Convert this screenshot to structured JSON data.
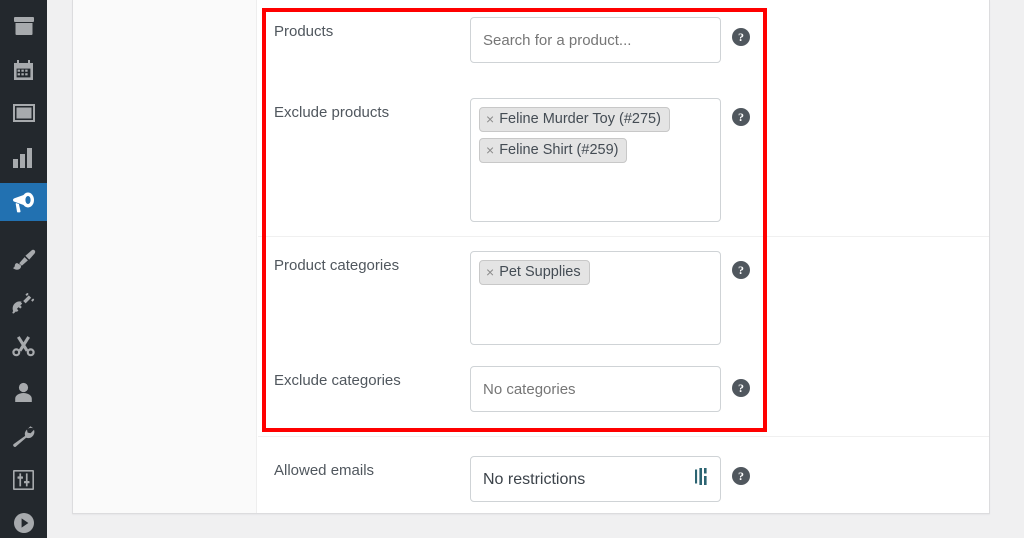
{
  "sidebar": {
    "items": [
      {
        "name": "archive-icon",
        "label": "Archive",
        "active": false
      },
      {
        "name": "calendar-icon",
        "label": "Bookings",
        "active": false
      },
      {
        "name": "cash-icon",
        "label": "Payments",
        "active": false
      },
      {
        "name": "bar-chart-icon",
        "label": "Analytics",
        "active": false
      },
      {
        "name": "megaphone-icon",
        "label": "Marketing",
        "active": true
      },
      {
        "name": "paintbrush-icon",
        "label": "Appearance",
        "active": false
      },
      {
        "name": "plug-icon",
        "label": "Plugins",
        "active": false
      },
      {
        "name": "scissors-icon",
        "label": "Coupons",
        "active": false
      },
      {
        "name": "user-icon",
        "label": "Users",
        "active": false
      },
      {
        "name": "wrench-icon",
        "label": "Tools",
        "active": false
      },
      {
        "name": "sliders-icon",
        "label": "Settings",
        "active": false
      },
      {
        "name": "play-circle-icon",
        "label": "Media",
        "active": false
      }
    ]
  },
  "colors": {
    "sidebar_bg": "#23282d",
    "sidebar_active": "#2271b1",
    "highlight_border": "#ff0000",
    "help_bubble": "#50575e",
    "resize_glyph": "#2c6472"
  },
  "help_icon_glyph": "?",
  "chip_remove_glyph": "×",
  "fields": [
    {
      "id": "products",
      "label": "Products",
      "control": "search-select",
      "placeholder": "Search for a product...",
      "value": "",
      "chips": [],
      "help": "help-tip-icon"
    },
    {
      "id": "exclude-products",
      "label": "Exclude products",
      "control": "multi-select",
      "placeholder": "",
      "chips": [
        "Feline Murder Toy (#275)",
        "Feline Shirt (#259)"
      ],
      "help": "help-tip-icon"
    },
    {
      "id": "product-categories",
      "label": "Product categories",
      "control": "multi-select",
      "placeholder": "",
      "chips": [
        "Pet Supplies"
      ],
      "help": "help-tip-icon"
    },
    {
      "id": "exclude-categories",
      "label": "Exclude categories",
      "control": "select",
      "placeholder": "No categories",
      "chips": [],
      "help": "help-tip-icon"
    },
    {
      "id": "allowed-emails",
      "label": "Allowed emails",
      "control": "text",
      "value": "No restrictions",
      "chips": [],
      "help": "help-tip-icon"
    }
  ]
}
